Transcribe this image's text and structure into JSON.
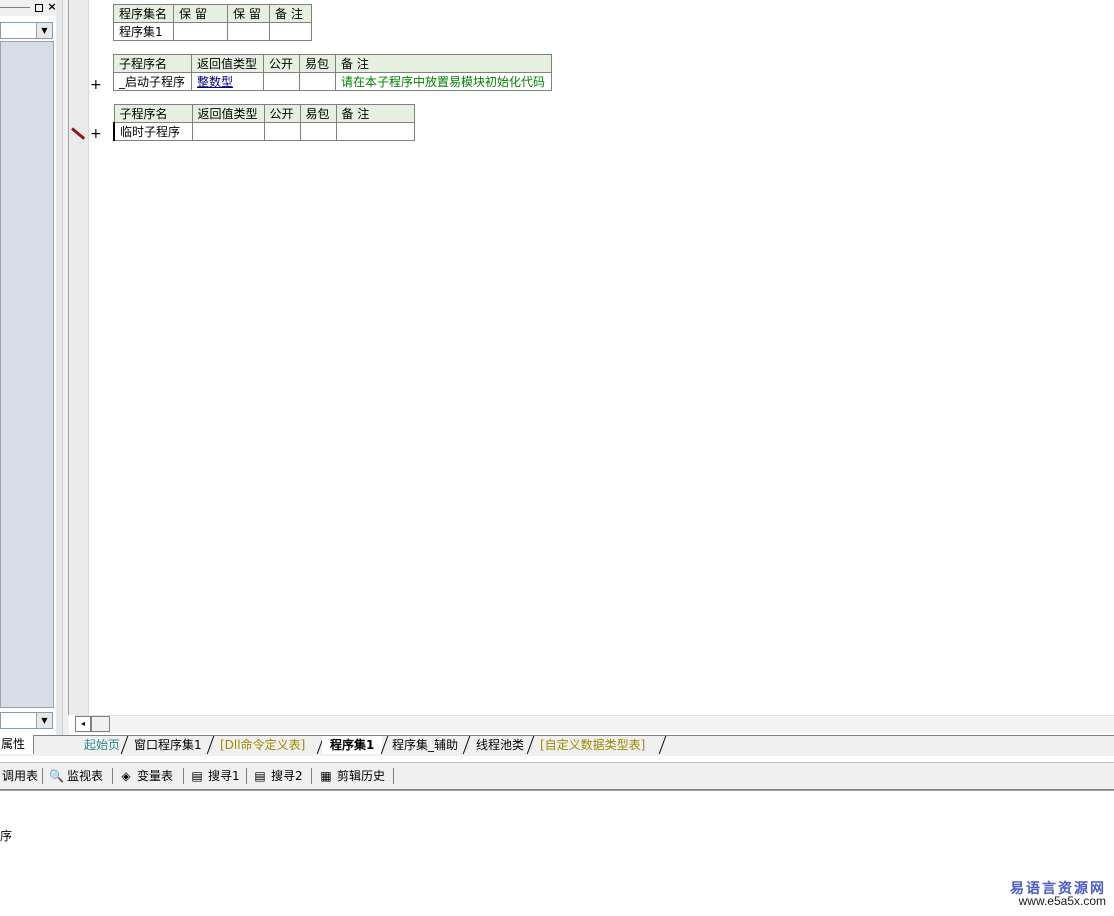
{
  "left_panel": {
    "pin_label": "",
    "close_label": "×",
    "combo_arrow": "▼",
    "tab_label": "属性"
  },
  "assembly_table": {
    "headers": [
      "程序集名",
      "保 留",
      "保 留",
      "备 注"
    ],
    "row": [
      "程序集1",
      "",
      "",
      ""
    ]
  },
  "sub1_table": {
    "headers": [
      "子程序名",
      "返回值类型",
      "公开",
      "易包",
      "备 注"
    ],
    "row": [
      "_启动子程序",
      "整数型",
      "",
      "",
      "请在本子程序中放置易模块初始化代码"
    ]
  },
  "sub2_table": {
    "headers": [
      "子程序名",
      "返回值类型",
      "公开",
      "易包",
      "备 注"
    ],
    "row": [
      "临时子程序",
      "",
      "",
      "",
      ""
    ]
  },
  "gutter": {
    "plus": "+"
  },
  "tabs": [
    {
      "label": "起始页",
      "color": "#2e8b8b"
    },
    {
      "label": "窗口程序集1",
      "color": "#000000"
    },
    {
      "label": "[Dll命令定义表]",
      "color": "#9a8a00"
    },
    {
      "label": "程序集1",
      "color": "#000000",
      "active": true
    },
    {
      "label": "程序集_辅助",
      "color": "#000000"
    },
    {
      "label": "线程池类",
      "color": "#000000"
    },
    {
      "label": "[自定义数据类型表]",
      "color": "#9a8a00"
    }
  ],
  "toolbar": {
    "items": [
      {
        "label": "调用表",
        "icon": ""
      },
      {
        "label": "监视表",
        "icon": "🔍"
      },
      {
        "label": "变量表",
        "icon": "◈"
      },
      {
        "label": "搜寻1",
        "icon": "▤"
      },
      {
        "label": "搜寻2",
        "icon": "▤"
      },
      {
        "label": "剪辑历史",
        "icon": "▦"
      }
    ]
  },
  "output": {
    "text": "序"
  },
  "watermark": {
    "title": "易语言资源网",
    "url": "www.e5a5x.com"
  },
  "colors": {
    "table_header_bg": "#e6f0e0",
    "remark_green": "#008000",
    "left_panel_bg": "#d6dde8"
  }
}
